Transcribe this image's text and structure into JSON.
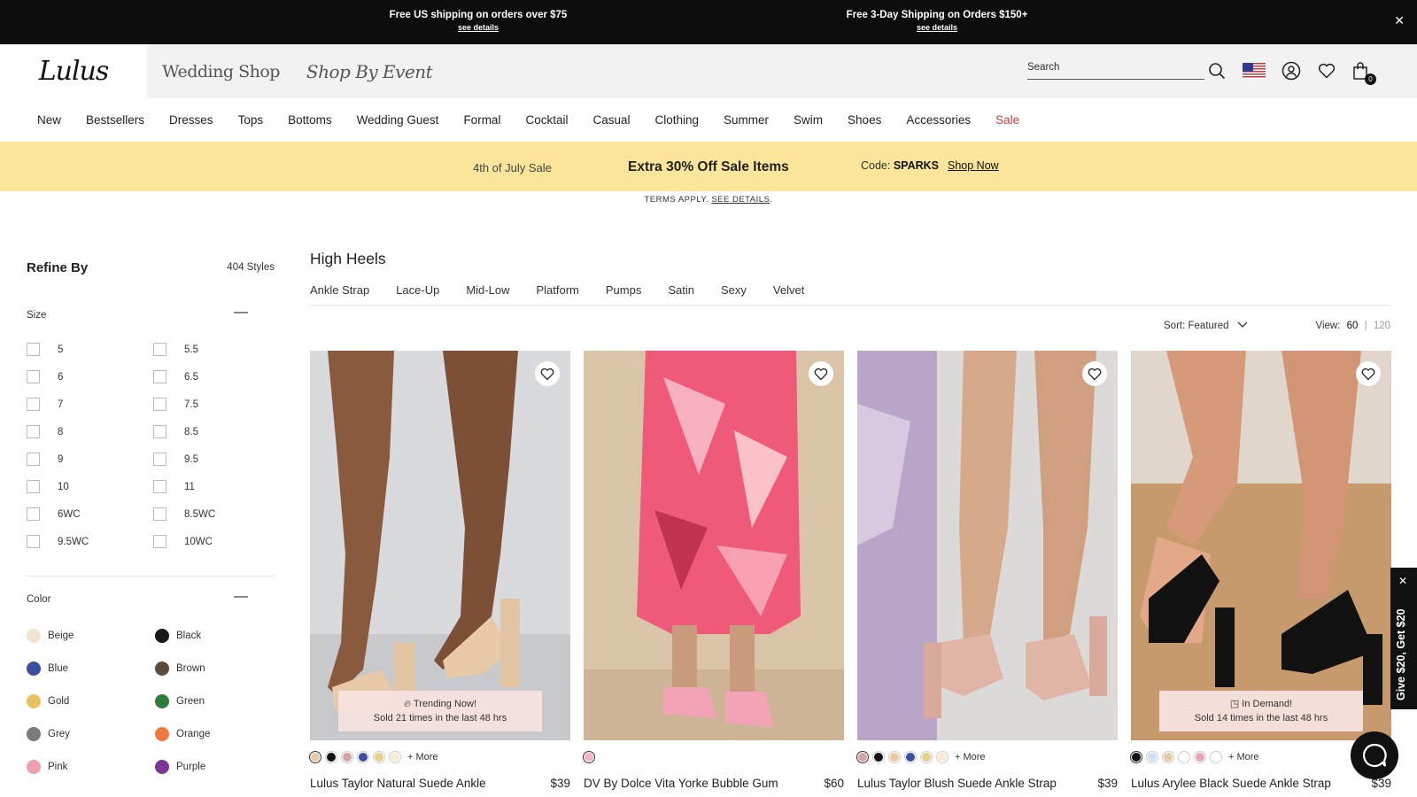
{
  "topbar": {
    "msg1": "Free US shipping on orders over $75",
    "msg1_link": "see details",
    "msg2": "Free 3-Day Shipping on Orders $150+",
    "msg2_link": "see details",
    "close": "x"
  },
  "header": {
    "logo": "Lulus",
    "wedding_shop": "Wedding Shop",
    "shop_by_event": "Shop By Event",
    "search_placeholder": "Search",
    "cart_count": "0"
  },
  "nav": [
    "New",
    "Bestsellers",
    "Dresses",
    "Tops",
    "Bottoms",
    "Wedding Guest",
    "Formal",
    "Cocktail",
    "Casual",
    "Clothing",
    "Summer",
    "Swim",
    "Shoes",
    "Accessories",
    "Sale"
  ],
  "promo": {
    "event": "4th of July Sale",
    "headline": "Extra 30% Off Sale Items",
    "code_label": "Code:",
    "code": "SPARKS",
    "cta": "Shop Now",
    "terms": "TERMS APPLY.",
    "terms_link": "SEE DETAILS"
  },
  "sidebar": {
    "title": "Refine By",
    "count": "404 Styles",
    "size_label": "Size",
    "sizes": [
      "5",
      "5.5",
      "6",
      "6.5",
      "7",
      "7.5",
      "8",
      "8.5",
      "9",
      "9.5",
      "10",
      "11",
      "6WC",
      "8.5WC",
      "9.5WC",
      "10WC"
    ],
    "color_label": "Color",
    "colors": [
      {
        "name": "Beige",
        "hex": "#efe5d2"
      },
      {
        "name": "Black",
        "hex": "#1a1a1a"
      },
      {
        "name": "Blue",
        "hex": "#3a4fa0"
      },
      {
        "name": "Brown",
        "hex": "#5c4a3d"
      },
      {
        "name": "Gold",
        "hex": "#e8c261"
      },
      {
        "name": "Green",
        "hex": "#2f7d3a"
      },
      {
        "name": "Grey",
        "hex": "#7a7a7a"
      },
      {
        "name": "Orange",
        "hex": "#ec7a3e"
      },
      {
        "name": "Pink",
        "hex": "#eea0b0"
      },
      {
        "name": "Purple",
        "hex": "#7b3796"
      }
    ]
  },
  "main": {
    "title": "High Heels",
    "subcategories": [
      "Ankle Strap",
      "Lace-Up",
      "Mid-Low",
      "Platform",
      "Pumps",
      "Satin",
      "Sexy",
      "Velvet"
    ],
    "sort_label": "Sort:",
    "sort_value": "Featured",
    "view_label": "View:",
    "view_selected": "60",
    "view_sep": "|",
    "view_other": "120"
  },
  "products": [
    {
      "name": "Lulus Taylor Natural Suede Ankle",
      "price": "$39",
      "badge_title": "Trending Now!",
      "badge_text": "Sold 21 times in the last 48 hrs",
      "swatches": [
        "#e8c9a8",
        "#111111",
        "#d4a4a2",
        "#3a4fa0",
        "#e8cf8a",
        "#f6ecd6"
      ],
      "more": "+ More"
    },
    {
      "name": "DV By Dolce Vita Yorke Bubble Gum",
      "price": "$60",
      "badge_title": "",
      "badge_text": "",
      "swatches": [
        "#f4b6c6"
      ],
      "more": ""
    },
    {
      "name": "Lulus Taylor Blush Suede Ankle Strap",
      "price": "$39",
      "badge_title": "",
      "badge_text": "",
      "swatches": [
        "#d4a4a2",
        "#111111",
        "#e8c9a8",
        "#3a4fa0",
        "#e8cf8a",
        "#f6ecd6"
      ],
      "more": "+ More"
    },
    {
      "name": "Lulus Arylee Black Suede Ankle Strap",
      "price": "$39",
      "badge_title": "In Demand!",
      "badge_text": "Sold 14 times in the last 48 hrs",
      "swatches": [
        "#111111",
        "#cfe0f2",
        "#e8c9a8",
        "#ffffff",
        "#e8a6b4",
        "#ffffff"
      ],
      "more": "+ More"
    }
  ],
  "give": {
    "text": "Give $20, Get $20"
  }
}
